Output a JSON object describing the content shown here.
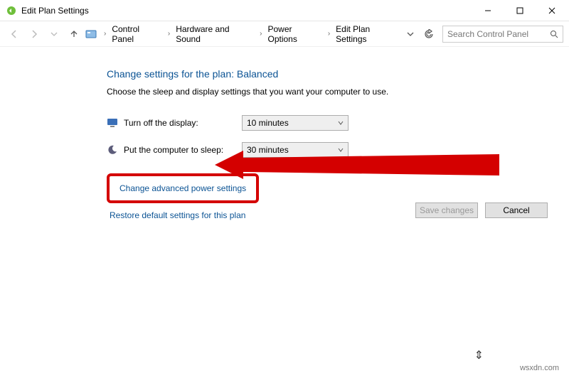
{
  "window": {
    "title": "Edit Plan Settings"
  },
  "breadcrumb": {
    "items": [
      "Control Panel",
      "Hardware and Sound",
      "Power Options",
      "Edit Plan Settings"
    ]
  },
  "search": {
    "placeholder": "Search Control Panel"
  },
  "page": {
    "heading": "Change settings for the plan: Balanced",
    "subtext": "Choose the sleep and display settings that you want your computer to use."
  },
  "settings": {
    "display_off": {
      "label": "Turn off the display:",
      "value": "10 minutes"
    },
    "sleep": {
      "label": "Put the computer to sleep:",
      "value": "30 minutes"
    }
  },
  "links": {
    "advanced": "Change advanced power settings",
    "restore": "Restore default settings for this plan"
  },
  "buttons": {
    "save": "Save changes",
    "cancel": "Cancel"
  },
  "watermark": "wsxdn.com"
}
